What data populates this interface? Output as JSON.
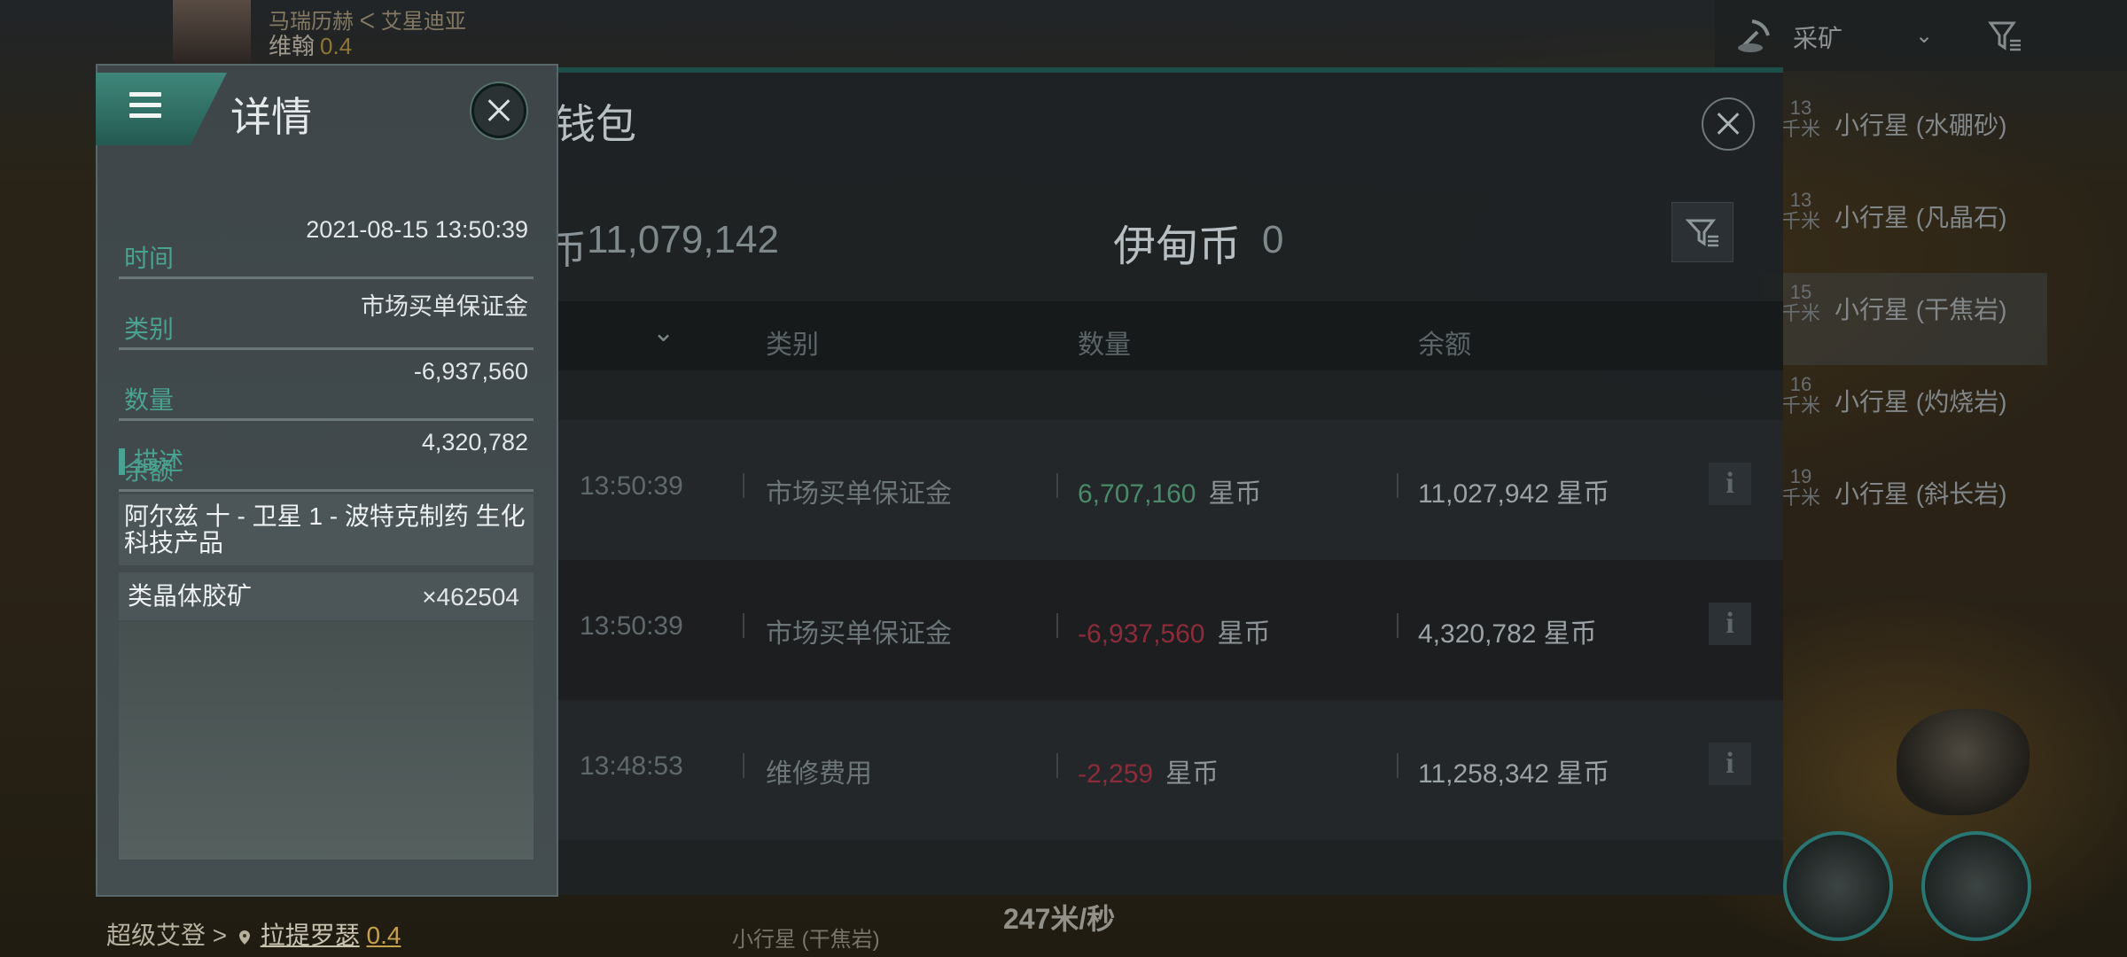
{
  "pilot": {
    "corp": "马瑞历赫 ᐸ 艾星迪亚",
    "name": "维翰",
    "security": "0.4"
  },
  "overview": {
    "title": "采矿",
    "items": [
      {
        "dist": "13",
        "unit": "千米",
        "name": "小行星 (水硼砂)",
        "selected": false
      },
      {
        "dist": "13",
        "unit": "千米",
        "name": "小行星 (凡晶石)",
        "selected": false
      },
      {
        "dist": "15",
        "unit": "千米",
        "name": "小行星 (干焦岩)",
        "selected": true
      },
      {
        "dist": "16",
        "unit": "千米",
        "name": "小行星 (灼烧岩)",
        "selected": false
      },
      {
        "dist": "19",
        "unit": "千米",
        "name": "小行星 (斜长岩)",
        "selected": false
      }
    ]
  },
  "location": {
    "region": "超级艾登",
    "sep": ">",
    "system": "拉提罗瑟",
    "security": "0.4"
  },
  "hud": {
    "speed": "247米/秒",
    "target": "小行星 (干焦岩)"
  },
  "wallet": {
    "title": "钱包",
    "isk_prefix": "币",
    "isk_balance": "11,079,142",
    "plex_label": "伊甸币",
    "plex_balance": "0",
    "columns": {
      "category": "类别",
      "amount": "数量",
      "balance": "余额"
    },
    "rows": [
      {
        "time": "13:50:39",
        "category": "市场买单保证金",
        "amount": "6,707,160",
        "unit": "星币",
        "sign": "pos",
        "balance": "11,027,942 星币"
      },
      {
        "time": "13:50:39",
        "category": "市场买单保证金",
        "amount": "-6,937,560",
        "unit": "星币",
        "sign": "neg",
        "balance": "4,320,782 星币"
      },
      {
        "time": "13:48:53",
        "category": "维修费用",
        "amount": "-2,259",
        "unit": "星币",
        "sign": "neg",
        "balance": "11,258,342 星币"
      }
    ]
  },
  "detail": {
    "title": "详情",
    "time_label": "时间",
    "time_value": "2021-08-15 13:50:39",
    "category_label": "类别",
    "category_value": "市场买单保证金",
    "amount_label": "数量",
    "amount_value": "-6,937,560",
    "balance_label": "余额",
    "balance_value": "4,320,782",
    "desc_label": "描述",
    "desc_location": "阿尔兹 十 - 卫星 1 - 波特克制药 生化科技产品",
    "item_name": "类晶体胶矿",
    "item_qty": "×462504"
  },
  "colors": {
    "accent": "#4aa290",
    "positive": "#4a8a68",
    "negative": "#8c2c3a",
    "security": "#c8a24a"
  }
}
